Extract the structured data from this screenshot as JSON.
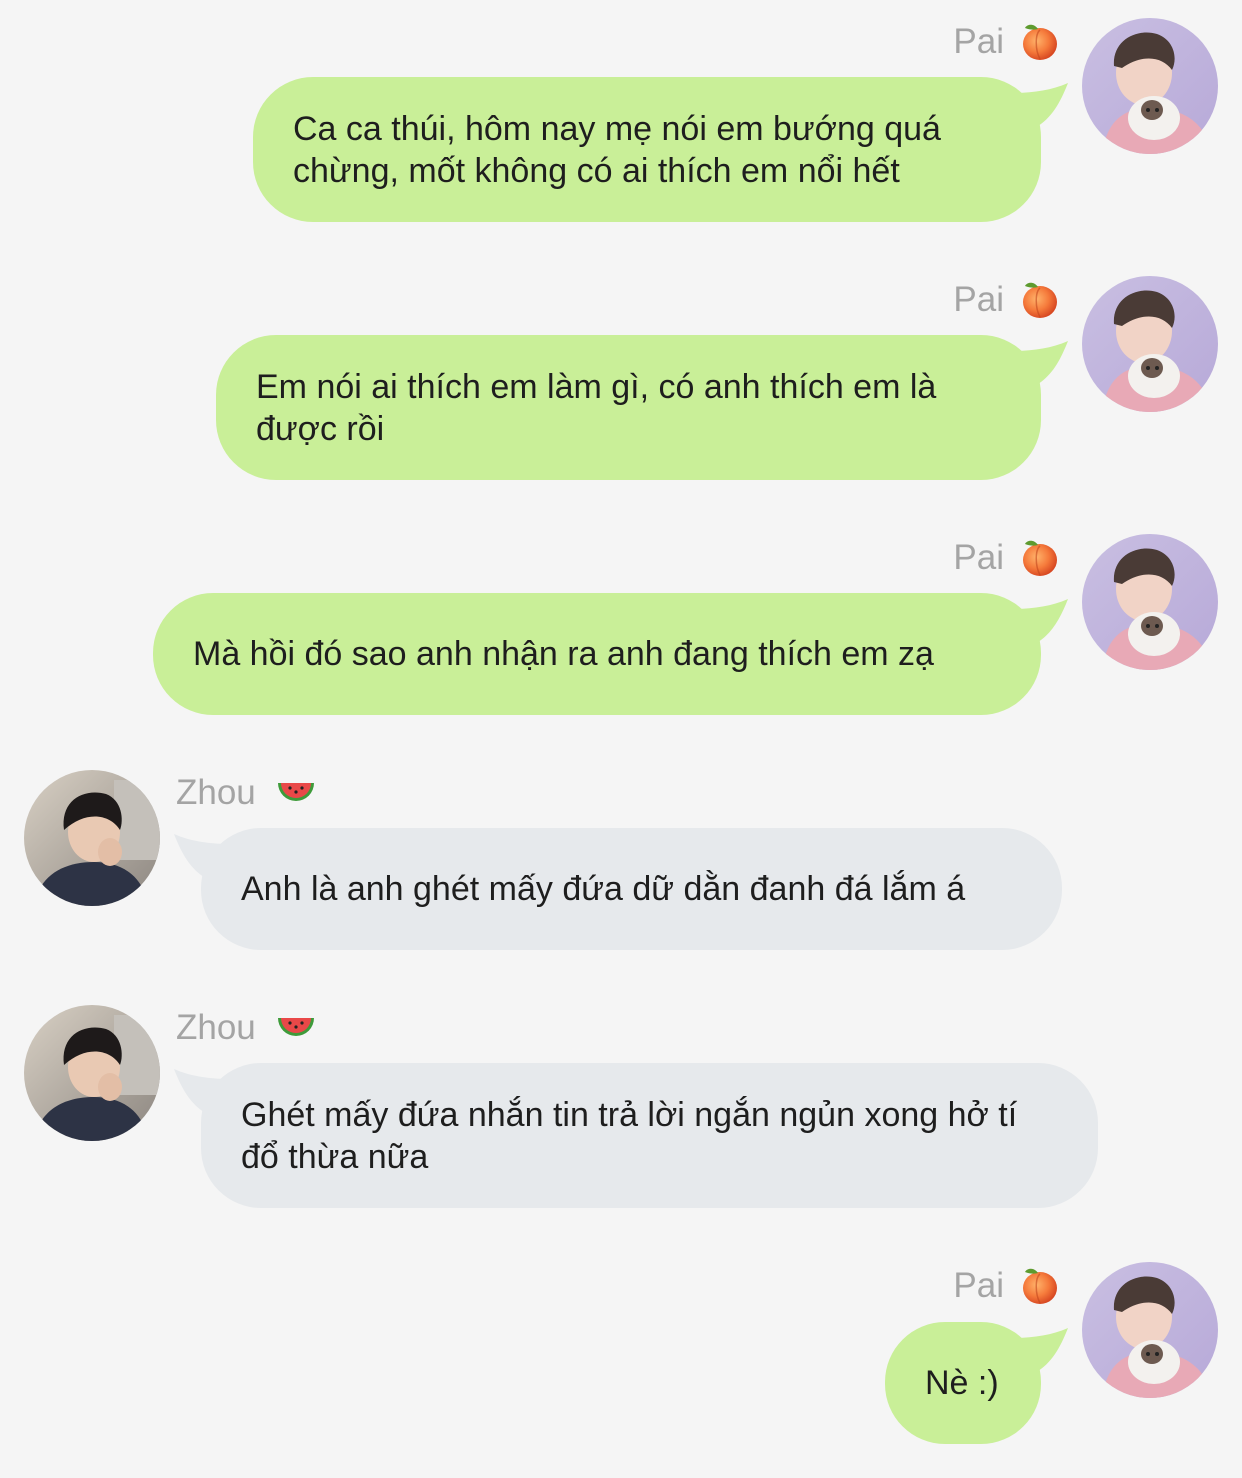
{
  "colors": {
    "background": "#f5f5f5",
    "outgoing_bubble": "#c9ef98",
    "incoming_bubble": "#e6e9ec",
    "name_text": "#a4a4a4"
  },
  "messages": [
    {
      "sender": "Pai",
      "direction": "outgoing",
      "emoji": "peach-emoji",
      "avatar": "avatar-pai",
      "text": "Ca ca thúi, hôm nay mẹ nói em bướng quá chừng, mốt không có ai thích em nổi hết"
    },
    {
      "sender": "Pai",
      "direction": "outgoing",
      "emoji": "peach-emoji",
      "avatar": "avatar-pai",
      "text": "Em nói ai thích em làm gì, có anh thích em là được rồi"
    },
    {
      "sender": "Pai",
      "direction": "outgoing",
      "emoji": "peach-emoji",
      "avatar": "avatar-pai",
      "text": "Mà hồi đó sao anh nhận ra anh đang thích em zạ"
    },
    {
      "sender": "Zhou",
      "direction": "incoming",
      "emoji": "watermelon-emoji",
      "avatar": "avatar-zhou",
      "text": "Anh là anh ghét mấy đứa dữ dằn đanh đá lắm á"
    },
    {
      "sender": "Zhou",
      "direction": "incoming",
      "emoji": "watermelon-emoji",
      "avatar": "avatar-zhou",
      "text": "Ghét mấy đứa nhắn tin trả lời ngắn ngủn xong hở tí đổ thừa nữa"
    },
    {
      "sender": "Pai",
      "direction": "outgoing",
      "emoji": "peach-emoji",
      "avatar": "avatar-pai",
      "text": "Nè :)"
    }
  ]
}
